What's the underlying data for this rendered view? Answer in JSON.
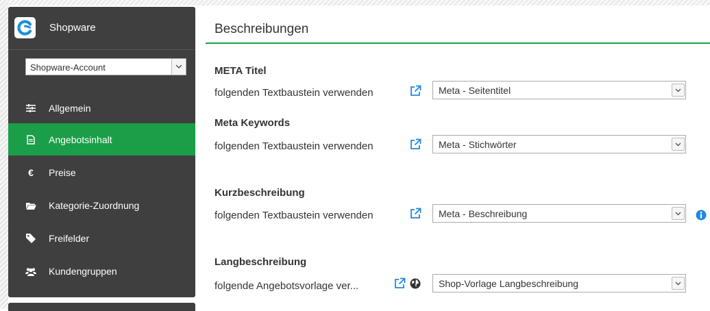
{
  "sidebar": {
    "brand": "Shopware",
    "account_select": "Shopware-Account",
    "items": [
      {
        "label": "Allgemein",
        "icon": "sliders-icon",
        "active": false
      },
      {
        "label": "Angebotsinhalt",
        "icon": "document-icon",
        "active": true
      },
      {
        "label": "Preise",
        "icon": "euro-icon",
        "active": false
      },
      {
        "label": "Kategorie-Zuordnung",
        "icon": "folder-icon",
        "active": false
      },
      {
        "label": "Freifelder",
        "icon": "tag-icon",
        "active": false
      },
      {
        "label": "Kundengruppen",
        "icon": "users-icon",
        "active": false
      }
    ]
  },
  "main": {
    "title": "Beschreibungen",
    "sections": [
      {
        "heading": "META Titel",
        "label": "folgenden Textbaustein verwenden",
        "value": "Meta - Seitentitel"
      },
      {
        "heading": "Meta Keywords",
        "label": "folgenden Textbaustein verwenden",
        "value": "Meta - Stichwörter"
      },
      {
        "heading": "Kurzbeschreibung",
        "label": "folgenden Textbaustein verwenden",
        "value": "Meta - Beschreibung"
      },
      {
        "heading": "Langbeschreibung",
        "label": "folgende Angebotsvorlage ver...",
        "value": "Shop-Vorlage Langbeschreibung"
      }
    ]
  },
  "colors": {
    "accent": "#1a9e48",
    "sidebar_bg": "#3f3f3f",
    "link_blue": "#1e88e5"
  }
}
